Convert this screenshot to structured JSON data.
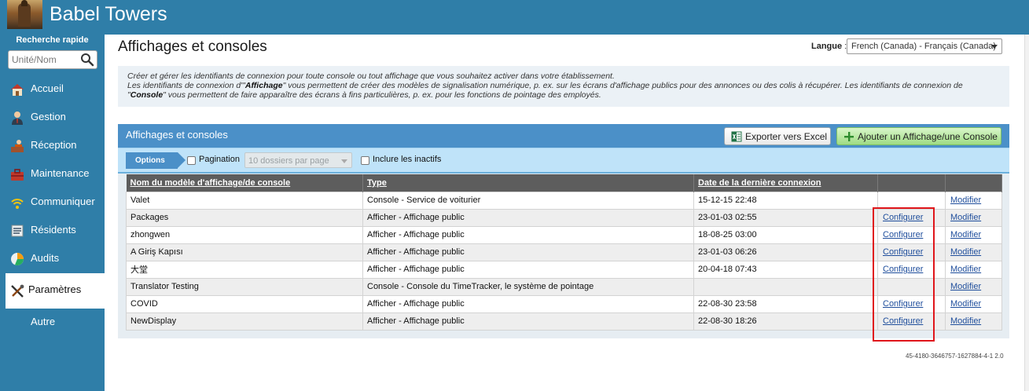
{
  "app": {
    "title": "Babel Towers"
  },
  "sidebar": {
    "quick_search_label": "Recherche rapide",
    "search_placeholder": "Unité/Nom",
    "items": [
      {
        "label": "Accueil",
        "icon": "house-icon"
      },
      {
        "label": "Gestion",
        "icon": "manager-person-icon"
      },
      {
        "label": "Réception",
        "icon": "reception-desk-icon"
      },
      {
        "label": "Maintenance",
        "icon": "toolbox-icon"
      },
      {
        "label": "Communiquer",
        "icon": "wifi-broadcast-icon"
      },
      {
        "label": "Résidents",
        "icon": "resident-list-icon"
      },
      {
        "label": "Audits",
        "icon": "pie-chart-icon"
      },
      {
        "label": "Paramètres",
        "icon": "tools-icon",
        "active": true
      },
      {
        "label": "Autre",
        "icon": ""
      }
    ]
  },
  "header": {
    "page_title": "Affichages et consoles",
    "language_label": "Langue",
    "language_value": "French (Canada) - Français (Canada)"
  },
  "intro": {
    "line1": "Créer et gérer les identifiants de connexion pour toute console ou tout affichage que vous souhaitez activer dans votre établissement.",
    "line2_a": "Les identifiants de connexion d'\"",
    "line2_b": "Affichage",
    "line2_c": "\" vous permettent de créer des modèles de signalisation numérique, p. ex. sur les écrans d'affichage publics pour des annonces ou des colis à récupérer. Les identifiants de connexion de",
    "line3_a": "\"",
    "line3_b": "Console",
    "line3_c": "\" vous permettent de faire apparaître des écrans à fins particulières, p. ex. pour les fonctions de pointage des employés."
  },
  "panel": {
    "title": "Affichages et consoles",
    "export_label": "Exporter vers Excel",
    "add_label": "Ajouter un Affichage/une Console",
    "options_label": "Options",
    "pagination_label": "Pagination",
    "per_page_value": "10 dossiers par page",
    "include_inactive_label": "Inclure les inactifs"
  },
  "table": {
    "columns": [
      "Nom du modèle d'affichage/de console",
      "Type",
      "Date de la dernière connexion",
      "",
      ""
    ],
    "rows": [
      {
        "name": "Valet",
        "type": "Console - Service de voiturier",
        "date": "15-12-15 22:48",
        "configure": "",
        "modify": "Modifier"
      },
      {
        "name": "Packages",
        "type": "Afficher - Affichage public",
        "date": "23-01-03 02:55",
        "configure": "Configurer",
        "modify": "Modifier"
      },
      {
        "name": "zhongwen",
        "type": "Afficher - Affichage public",
        "date": "18-08-25 03:00",
        "configure": "Configurer",
        "modify": "Modifier"
      },
      {
        "name": "A Giriş Kapısı",
        "type": "Afficher - Affichage public",
        "date": "23-01-03 06:26",
        "configure": "Configurer",
        "modify": "Modifier"
      },
      {
        "name": "大堂",
        "type": "Afficher - Affichage public",
        "date": "20-04-18 07:43",
        "configure": "Configurer",
        "modify": "Modifier"
      },
      {
        "name": "Translator Testing",
        "type": "Console - Console du TimeTracker, le système de pointage",
        "date": "",
        "configure": "",
        "modify": "Modifier"
      },
      {
        "name": "COVID",
        "type": "Afficher - Affichage public",
        "date": "22-08-30 23:58",
        "configure": "Configurer",
        "modify": "Modifier"
      },
      {
        "name": "NewDisplay",
        "type": "Afficher - Affichage public",
        "date": "22-08-30 18:26",
        "configure": "Configurer",
        "modify": "Modifier"
      }
    ]
  },
  "footer": {
    "version": "45-4180-3646757-1627884-4-1 2.0"
  },
  "colors": {
    "brand": "#2f7ea8",
    "panel_header": "#4b90c8",
    "highlight": "#e0161b",
    "add_button": "#9fdc84"
  }
}
